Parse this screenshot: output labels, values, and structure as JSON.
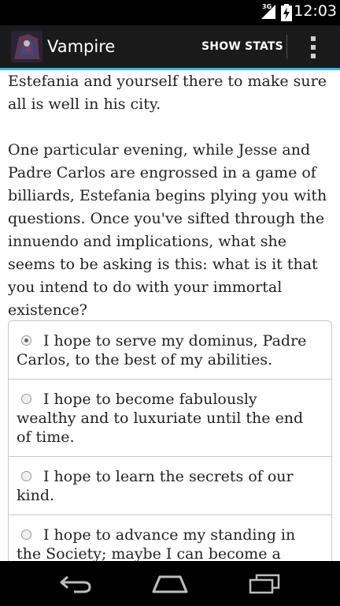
{
  "status_bar": {
    "network": "3G",
    "time": "12:03"
  },
  "action_bar": {
    "title": "Vampire",
    "show_stats_label": "SHOW STATS",
    "overflow_icon": "overflow-menu-icon",
    "accent_color": "#33b5e5"
  },
  "story": {
    "paragraphs": [
      "Estefania and yourself there to make sure all is well in his city.",
      "One particular evening, while Jesse and Padre Carlos are engrossed in a game of billiards, Estefania begins plying you with questions. Once you've sifted through the innuendo and implications, what she seems to be asking is this: what is it that you intend to do with your immortal existence?"
    ]
  },
  "choices": {
    "selected_index": 0,
    "items": [
      {
        "label": "I hope to serve my dominus, Padre Carlos, to the best of my abilities."
      },
      {
        "label": "I hope to become fabulously wealthy and to luxuriate until the end of time."
      },
      {
        "label": "I hope to learn the secrets of our kind."
      },
      {
        "label": "I hope to advance my standing in the Society; maybe I can become a quaestor or even a senator some day."
      }
    ]
  },
  "nav_bar": {
    "back_icon": "back-arrow-icon",
    "home_icon": "home-icon",
    "recents_icon": "recent-apps-icon"
  }
}
